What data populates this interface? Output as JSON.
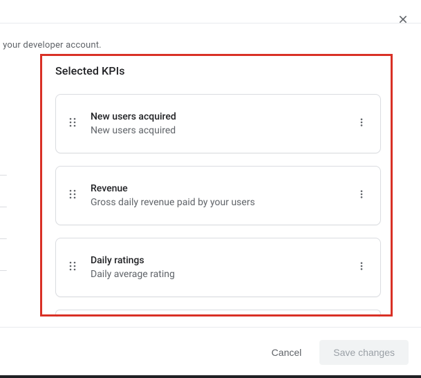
{
  "truncated_header": "in your developer account.",
  "section_title": "Selected KPIs",
  "kpis": [
    {
      "title": "New users acquired",
      "subtitle": "New users acquired"
    },
    {
      "title": "Revenue",
      "subtitle": "Gross daily revenue paid by your users"
    },
    {
      "title": "Daily ratings",
      "subtitle": "Daily average rating"
    }
  ],
  "footer": {
    "cancel_label": "Cancel",
    "save_label": "Save changes"
  }
}
